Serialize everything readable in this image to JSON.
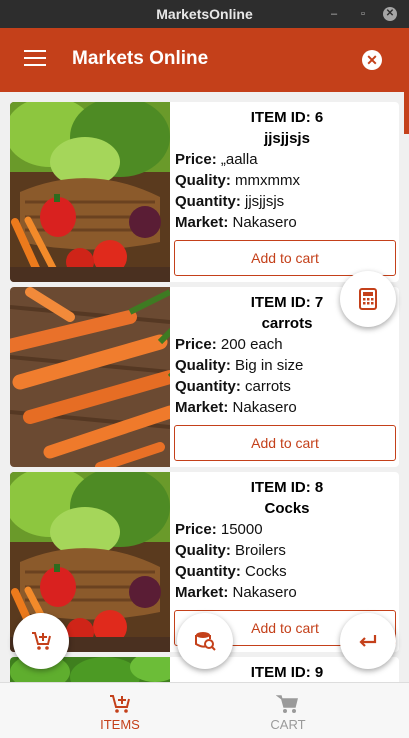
{
  "window": {
    "title": "MarketsOnline",
    "min_glyph": "–",
    "max_glyph": "▫",
    "close_glyph": "✕"
  },
  "appbar": {
    "title": "Markets Online",
    "close_glyph": "✕"
  },
  "labels": {
    "price": "Price:",
    "quality": "Quality:",
    "quantity": "Quantity:",
    "market": "Market:",
    "add_to_cart": "Add to cart"
  },
  "items": [
    {
      "id": "ITEM ID: 6",
      "name": "jjsjjsjs",
      "price": " „aalla",
      "quality": " mmxmmx",
      "quantity": " jjsjjsjs",
      "market": " Nakasero",
      "image": "vegetable-basket"
    },
    {
      "id": "ITEM ID: 7",
      "name": "carrots",
      "price": " 200 each",
      "quality": " Big in size",
      "quantity": " carrots",
      "market": " Nakasero",
      "image": "carrots"
    },
    {
      "id": "ITEM ID: 8",
      "name": "Cocks",
      "price": " 15000",
      "quality": " Broilers",
      "quantity": " Cocks",
      "market": " Nakasero",
      "image": "vegetable-basket"
    },
    {
      "id": "ITEM ID: 9",
      "image": "green-vegetables"
    }
  ],
  "fabs": [
    "calculator-icon",
    "add-cart-icon",
    "search-market-icon",
    "return-icon"
  ],
  "nav": {
    "items_label": "ITEMS",
    "cart_label": "CART",
    "active": "ITEMS"
  },
  "colors": {
    "primary": "#c4401a",
    "background": "#f0f0f0",
    "inactive": "#9a9a9a"
  }
}
